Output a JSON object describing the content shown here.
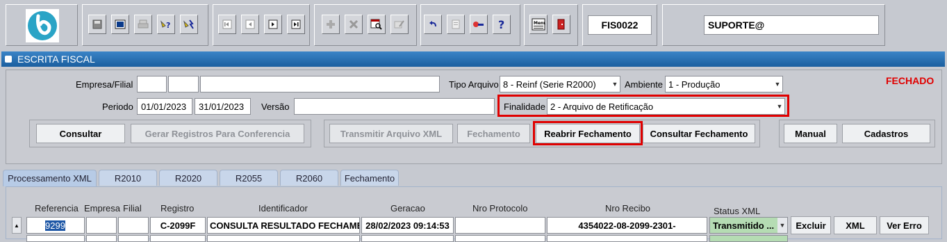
{
  "toolbar": {
    "icons": [
      "logo-d",
      "save-icon",
      "window-icon",
      "print-icon",
      "query-help-icon",
      "execute-query-icon",
      "first-record-icon",
      "previous-record-icon",
      "next-record-icon",
      "last-record-icon",
      "insert-record-icon",
      "delete-record-icon",
      "query-icon",
      "edit-icon",
      "undo-icon",
      "clear-icon",
      "key-icon",
      "help-icon",
      "menu-icon",
      "exit-icon"
    ],
    "form_code": "FIS0022",
    "user": "SUPORTE@",
    "menu_glyph": "Menu"
  },
  "window": {
    "title": "ESCRITA FISCAL",
    "status": "FECHADO"
  },
  "form": {
    "empresa_label": "Empresa/Filial",
    "tipo_label": "Tipo Arquivo",
    "tipo_value": "8 - Reinf (Serie R2000)",
    "ambiente_label": "Ambiente",
    "ambiente_value": "1 - Produção",
    "periodo_label": "Periodo",
    "periodo_start": "01/01/2023",
    "periodo_end": "31/01/2023",
    "versao_label": "Versão",
    "finalidade_label": "Finalidade",
    "finalidade_value": "2 - Arquivo de Retificação"
  },
  "buttons": {
    "consultar": "Consultar",
    "gerar": "Gerar Registros Para Conferencia",
    "transmitir": "Transmitir Arquivo XML",
    "fechamento": "Fechamento",
    "reabrir": "Reabrir Fechamento",
    "consultar_fechamento": "Consultar Fechamento",
    "manual": "Manual",
    "cadastros": "Cadastros"
  },
  "tabs": [
    "Processamento XML",
    "R2010",
    "R2020",
    "R2055",
    "R2060",
    "Fechamento"
  ],
  "grid": {
    "headers": {
      "referencia": "Referencia",
      "empresa": "Empresa",
      "filial": "Filial",
      "registro": "Registro",
      "identificador": "Identificador",
      "geracao": "Geracao",
      "protocolo": "Nro Protocolo",
      "recibo": "Nro Recibo",
      "status": "Status XML"
    },
    "row": {
      "referencia": "9299",
      "empresa": "",
      "filial": "",
      "registro": "C-2099F",
      "identificador": "CONSULTA RESULTADO FECHAME",
      "geracao": "28/02/2023 09:14:53",
      "protocolo": "",
      "recibo": "4354022-08-2099-2301-",
      "status": "Transmitido ..."
    },
    "row_buttons": {
      "excluir": "Excluir",
      "xml": "XML",
      "ver_erro": "Ver Erro"
    }
  }
}
